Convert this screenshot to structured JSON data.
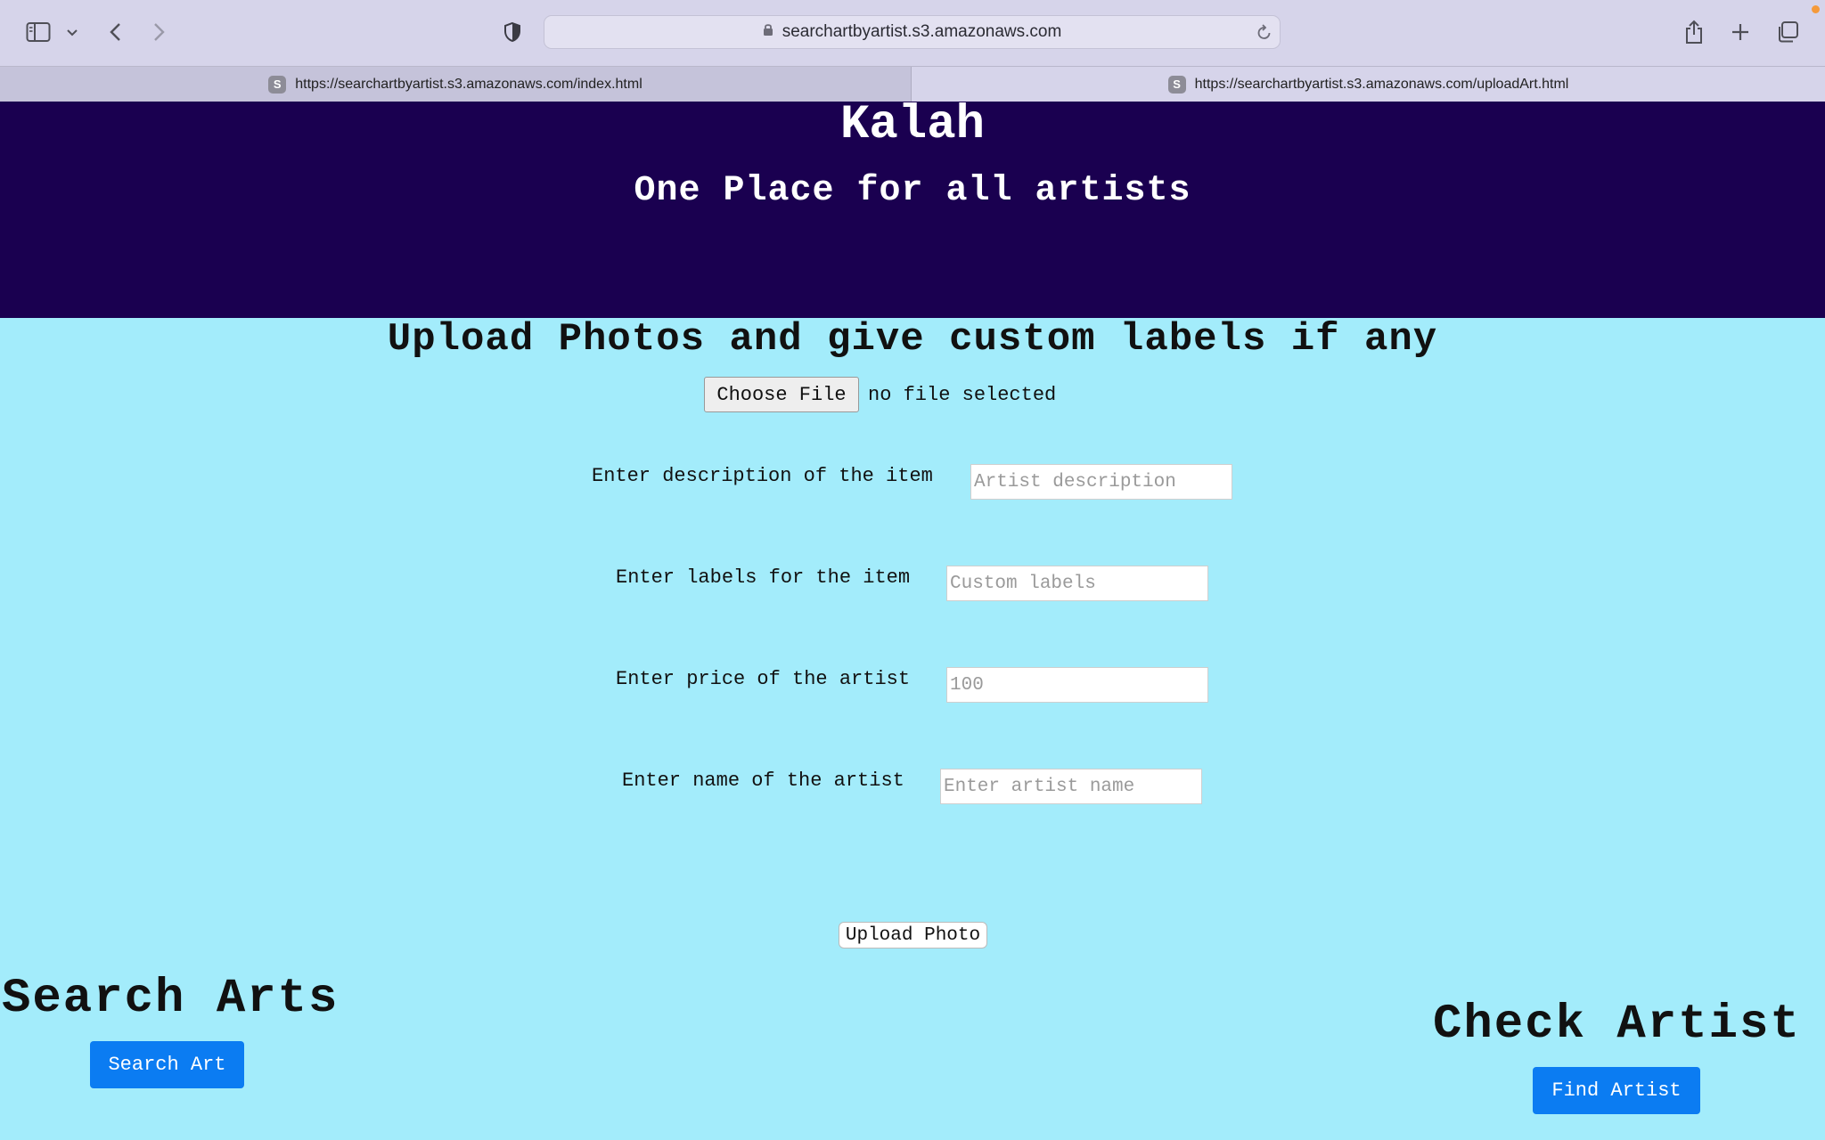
{
  "browser": {
    "url": "searchartbyartist.s3.amazonaws.com",
    "tabs": [
      {
        "favicon": "S",
        "label": "https://searchartbyartist.s3.amazonaws.com/index.html"
      },
      {
        "favicon": "S",
        "label": "https://searchartbyartist.s3.amazonaws.com/uploadArt.html"
      }
    ],
    "icons": [
      "sidebar-icon",
      "chevron-down-icon",
      "back-icon",
      "forward-icon",
      "shield-icon",
      "lock-icon",
      "reload-icon",
      "share-icon",
      "plus-icon",
      "tabs-overview-icon"
    ]
  },
  "header": {
    "title": "Kalah",
    "tagline": "One Place for all artists",
    "background": "#1a0050"
  },
  "upload": {
    "heading": "Upload Photos and give custom labels if any",
    "choose_file_label": "Choose File",
    "file_status": "no file selected",
    "fields": [
      {
        "label": "Enter description of the item",
        "placeholder": "Artist description"
      },
      {
        "label": "Enter labels for the item",
        "placeholder": "Custom labels"
      },
      {
        "label": "Enter price of the artist",
        "placeholder": "100"
      },
      {
        "label": "Enter name of the artist",
        "placeholder": "Enter artist name"
      }
    ],
    "submit_label": "Upload Photo"
  },
  "search": {
    "heading": "Search Arts",
    "button_label": "Search Art"
  },
  "artist": {
    "heading": "Check Artist",
    "button_label": "Find Artist"
  },
  "colors": {
    "page_background": "#a3ecfb",
    "button_blue": "#0b7cf2"
  }
}
